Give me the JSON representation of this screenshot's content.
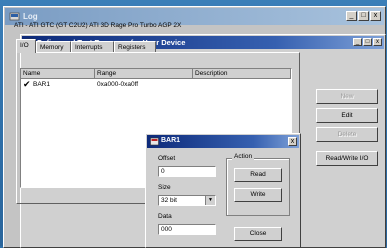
{
  "outer_window": {
    "title": "Log",
    "buttons": [
      "_",
      "□",
      "x"
    ]
  },
  "dialog": {
    "title": "Define and Test Resource for Your Device",
    "device": "ATI - ATI GTC (GT C2U2) ATI 3D Rage Pro Turbo AGP 2X",
    "tabs": [
      "I/O",
      "Memory",
      "Interrupts",
      "Registers"
    ],
    "columns": [
      "Name",
      "Range",
      "Description"
    ],
    "rows": [
      {
        "checked": true,
        "name": "BAR1",
        "range": "0xa000-0xa0ff",
        "description": ""
      }
    ],
    "buttons": {
      "new": "New",
      "edit": "Edit",
      "delete": "Delete",
      "readwrite": "Read/Write I/O"
    }
  },
  "bar_dialog": {
    "title": "BAR1",
    "offset_label": "Offset",
    "offset_value": "0",
    "size_label": "Size",
    "size_value": "32 bit",
    "data_label": "Data",
    "data_value": "000",
    "action_label": "Action",
    "read_label": "Read",
    "write_label": "Write",
    "close_label": "Close"
  }
}
